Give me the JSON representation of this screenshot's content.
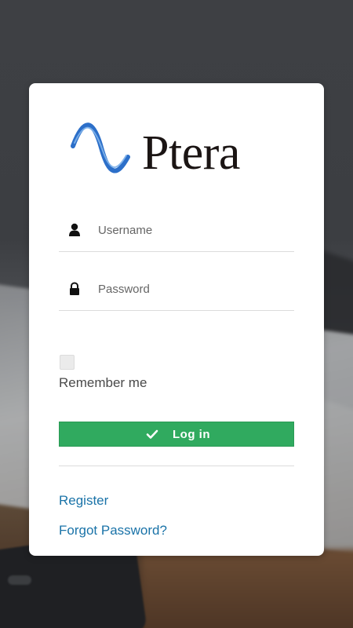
{
  "app": {
    "logo_text": "Ptera"
  },
  "login_form": {
    "username": {
      "placeholder": "Username",
      "value": ""
    },
    "password": {
      "placeholder": "Password",
      "value": ""
    },
    "remember_label": "Remember me",
    "remember_checked": false,
    "login_label": "Log in"
  },
  "links": {
    "register": "Register",
    "forgot_password": "Forgot Password?"
  },
  "icons": {
    "username": "user-icon",
    "password": "lock-icon",
    "login": "check-icon",
    "logo": "wave-logo-icon"
  },
  "colors": {
    "primary_button": "#30aa5f",
    "link": "#1a73a8",
    "logo_wave": "#2c6fc9",
    "logo_text": "#1b1514"
  }
}
